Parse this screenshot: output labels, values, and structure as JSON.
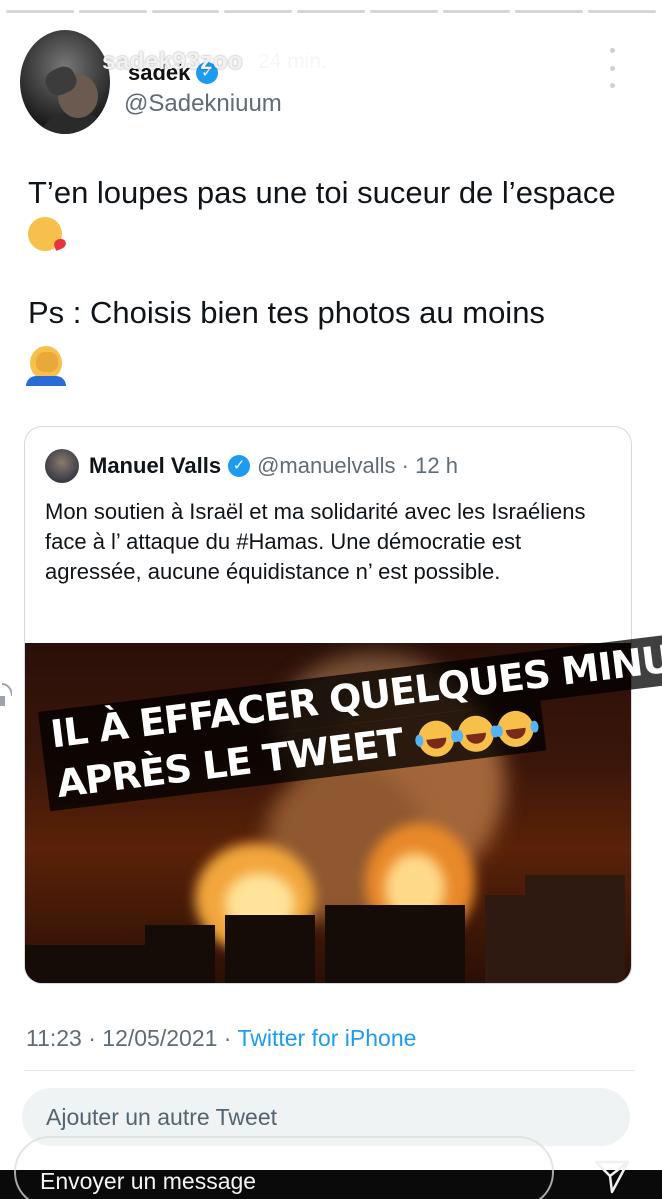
{
  "story": {
    "username": "sadek93zoo",
    "time": "24 min.",
    "progress_segments": 9,
    "progress_done": 9,
    "reply_placeholder": "Envoyer un message"
  },
  "tweet": {
    "author_name": "sadek",
    "author_handle": "@Sadekniuum",
    "text_1": "T’en loupes pas une toi suceur de l’espace",
    "text_2": "Ps : Choisis bien tes photos au moins",
    "emoji_1": "kissing-face-icon",
    "emoji_2": "facepalm-icon",
    "timestamp": "11:23 · 12/05/2021 ·",
    "source": "Twitter for iPhone",
    "reply_placeholder": "Ajouter un autre Tweet"
  },
  "quoted": {
    "name": "Manuel Valls",
    "handle": "@manuelvalls · 12 h",
    "body": "Mon soutien à Israël et ma solidarité avec les Israéliens face à l’ attaque du #Hamas. Une démocratie est agressée, aucune équidistance n’ est possible."
  },
  "overlay_caption": {
    "line_1": "IL À EFFACER QUELQUES MINUTES",
    "line_2": "APRÈS LE TWEET",
    "emoji": "laughing-tears-icon",
    "emoji_count": 3
  },
  "colors": {
    "verified": "#1d9bf0",
    "link": "#1d9bf0",
    "muted": "#5f6b75",
    "text": "#0f1419"
  }
}
